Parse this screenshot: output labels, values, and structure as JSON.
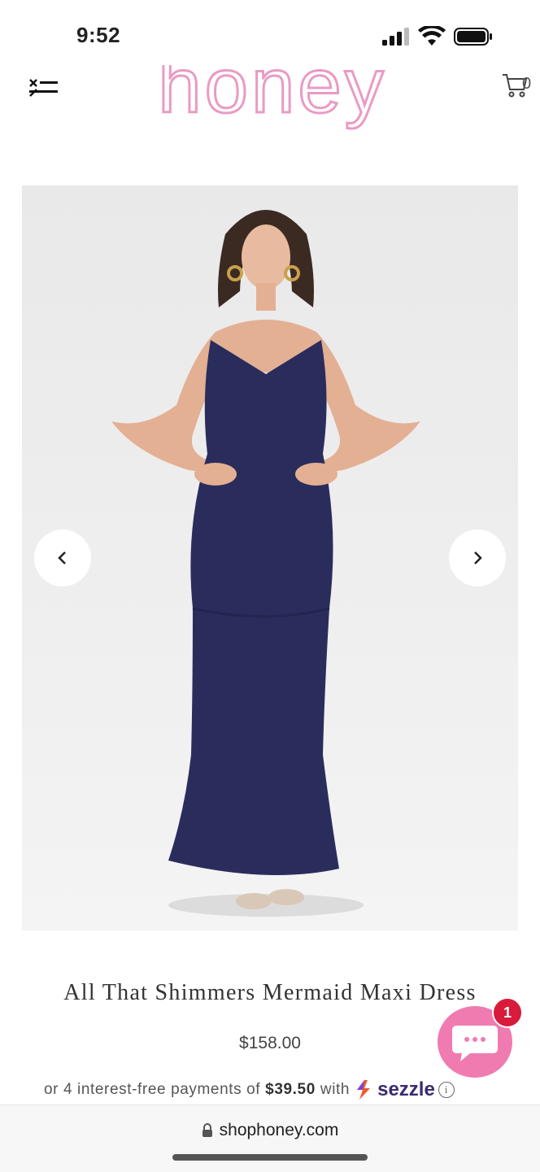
{
  "status_bar": {
    "time": "9:52"
  },
  "header": {
    "logo_text": "honey",
    "cart_count": "0",
    "brand_color": "#e99bc4"
  },
  "product": {
    "title": "All That Shimmers Mermaid Maxi Dress",
    "price": "$158.00",
    "installment_prefix": "or 4 interest-free payments of",
    "installment_amount": "$39.50",
    "installment_suffix": "with",
    "provider": "sezzle",
    "info_symbol": "i",
    "dress_color": "#2a2d5c"
  },
  "gallery": {
    "prev_icon": "chevron-left-icon",
    "next_icon": "chevron-right-icon"
  },
  "chat": {
    "badge_count": "1",
    "color": "#f07bb0"
  },
  "browser": {
    "url": "shophoney.com"
  }
}
